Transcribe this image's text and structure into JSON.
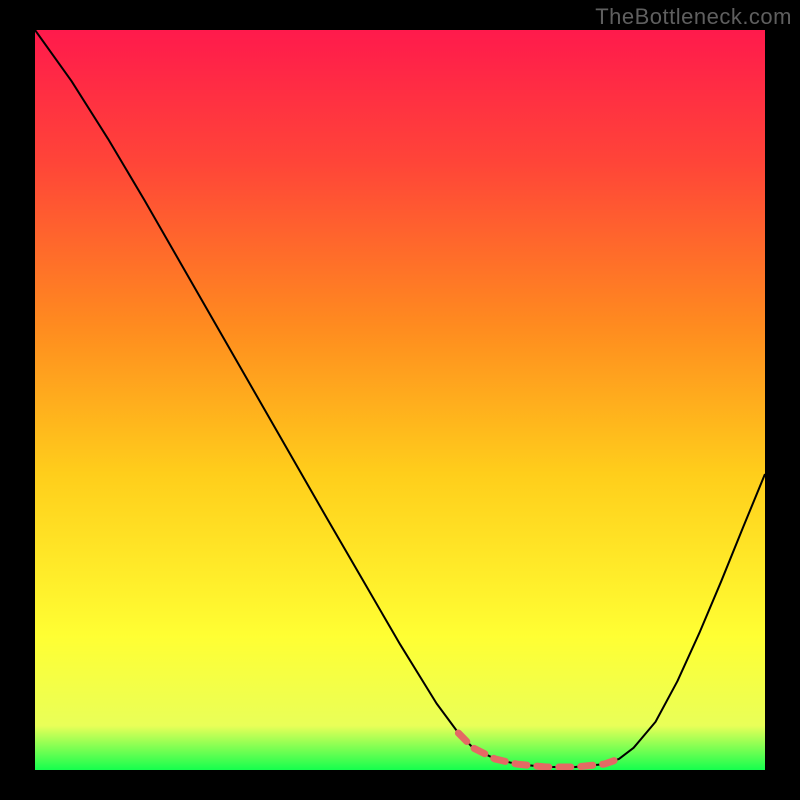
{
  "watermark": "TheBottleneck.com",
  "chart_data": {
    "type": "line",
    "title": "",
    "xlabel": "",
    "ylabel": "",
    "xlim": [
      0,
      100
    ],
    "ylim": [
      0,
      100
    ],
    "grid": false,
    "gradient_stops": [
      {
        "offset": 0,
        "color": "#ff1a4c"
      },
      {
        "offset": 0.18,
        "color": "#ff4538"
      },
      {
        "offset": 0.4,
        "color": "#ff8b1f"
      },
      {
        "offset": 0.6,
        "color": "#ffce1b"
      },
      {
        "offset": 0.82,
        "color": "#ffff33"
      },
      {
        "offset": 0.94,
        "color": "#e9ff58"
      },
      {
        "offset": 1.0,
        "color": "#15ff4e"
      }
    ],
    "series": [
      {
        "name": "curve",
        "stroke": "#000000",
        "stroke_width": 2,
        "x": [
          0,
          5,
          10,
          15,
          20,
          25,
          30,
          35,
          40,
          45,
          50,
          55,
          58,
          60,
          63,
          66,
          70,
          74,
          78,
          80,
          82,
          85,
          88,
          91,
          94,
          97,
          100
        ],
        "y": [
          100.0,
          93.1,
          85.3,
          77.0,
          68.4,
          59.8,
          51.2,
          42.6,
          34.0,
          25.5,
          17.0,
          9.0,
          5.0,
          3.0,
          1.5,
          0.8,
          0.4,
          0.4,
          0.8,
          1.5,
          3.0,
          6.5,
          12.0,
          18.5,
          25.5,
          32.8,
          40.0
        ]
      },
      {
        "name": "highlight-segments",
        "stroke": "#e46a64",
        "stroke_width": 7,
        "segments": [
          {
            "x": [
              58,
              60,
              63,
              66,
              70,
              74,
              78,
              80
            ],
            "y": [
              5.0,
              3.0,
              1.5,
              0.8,
              0.4,
              0.4,
              0.8,
              1.5
            ]
          }
        ]
      }
    ]
  }
}
